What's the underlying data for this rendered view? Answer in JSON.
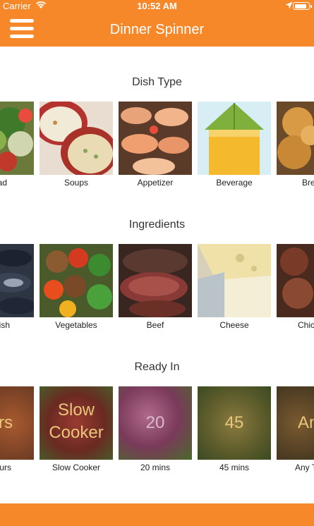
{
  "status_bar": {
    "carrier": "Carrier",
    "time": "10:52 AM",
    "battery_level": 0.9
  },
  "nav": {
    "title": "Dinner Spinner",
    "menu_icon": "hamburger-menu-icon"
  },
  "sections": {
    "dish_type": {
      "title": "Dish Type",
      "items": [
        {
          "label": "ad"
        },
        {
          "label": "Soups"
        },
        {
          "label": "Appetizer"
        },
        {
          "label": "Beverage"
        },
        {
          "label": "Bre"
        }
      ]
    },
    "ingredients": {
      "title": "Ingredients",
      "items": [
        {
          "label": "fish"
        },
        {
          "label": "Vegetables"
        },
        {
          "label": "Beef"
        },
        {
          "label": "Cheese"
        },
        {
          "label": "Chic"
        }
      ]
    },
    "ready_in": {
      "title": "Ready In",
      "items": [
        {
          "label": "ours",
          "overlay": "urs"
        },
        {
          "label": "Slow Cooker",
          "overlay_line1": "Slow",
          "overlay_line2": "Cooker"
        },
        {
          "label": "20 mins",
          "overlay": "20"
        },
        {
          "label": "45 mins",
          "overlay": "45"
        },
        {
          "label": "Any T",
          "overlay": "An"
        }
      ]
    }
  },
  "colors": {
    "accent": "#f7882a",
    "overlay_text": "#e8c67a"
  }
}
